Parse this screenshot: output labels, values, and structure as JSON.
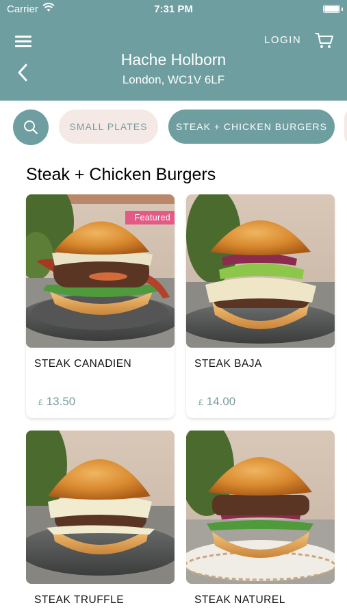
{
  "status_bar": {
    "carrier": "Carrier",
    "time": "7:31 PM"
  },
  "header": {
    "login_label": "LOGIN",
    "restaurant_name": "Hache Holborn",
    "address": "London, WC1V 6LF",
    "icons": {
      "menu": "hamburger-menu-icon",
      "cart": "shopping-cart-icon",
      "back": "chevron-left-icon"
    }
  },
  "categories": [
    {
      "label": "SMALL PLATES",
      "active": false
    },
    {
      "label": "STEAK + CHICKEN BURGERS",
      "active": true
    }
  ],
  "section_title": "Steak + Chicken Burgers",
  "products": [
    {
      "name": "STEAK CANADIEN",
      "currency": "£",
      "price": "13.50",
      "badge": "Featured"
    },
    {
      "name": "STEAK BAJA",
      "currency": "£",
      "price": "14.00"
    },
    {
      "name": "STEAK TRUFFLE"
    },
    {
      "name": "STEAK NATUREL"
    }
  ],
  "colors": {
    "brand": "#6e9ea0",
    "pill_inactive": "#f4e9e5",
    "badge": "#e35a86",
    "price": "#7a9b9d"
  }
}
